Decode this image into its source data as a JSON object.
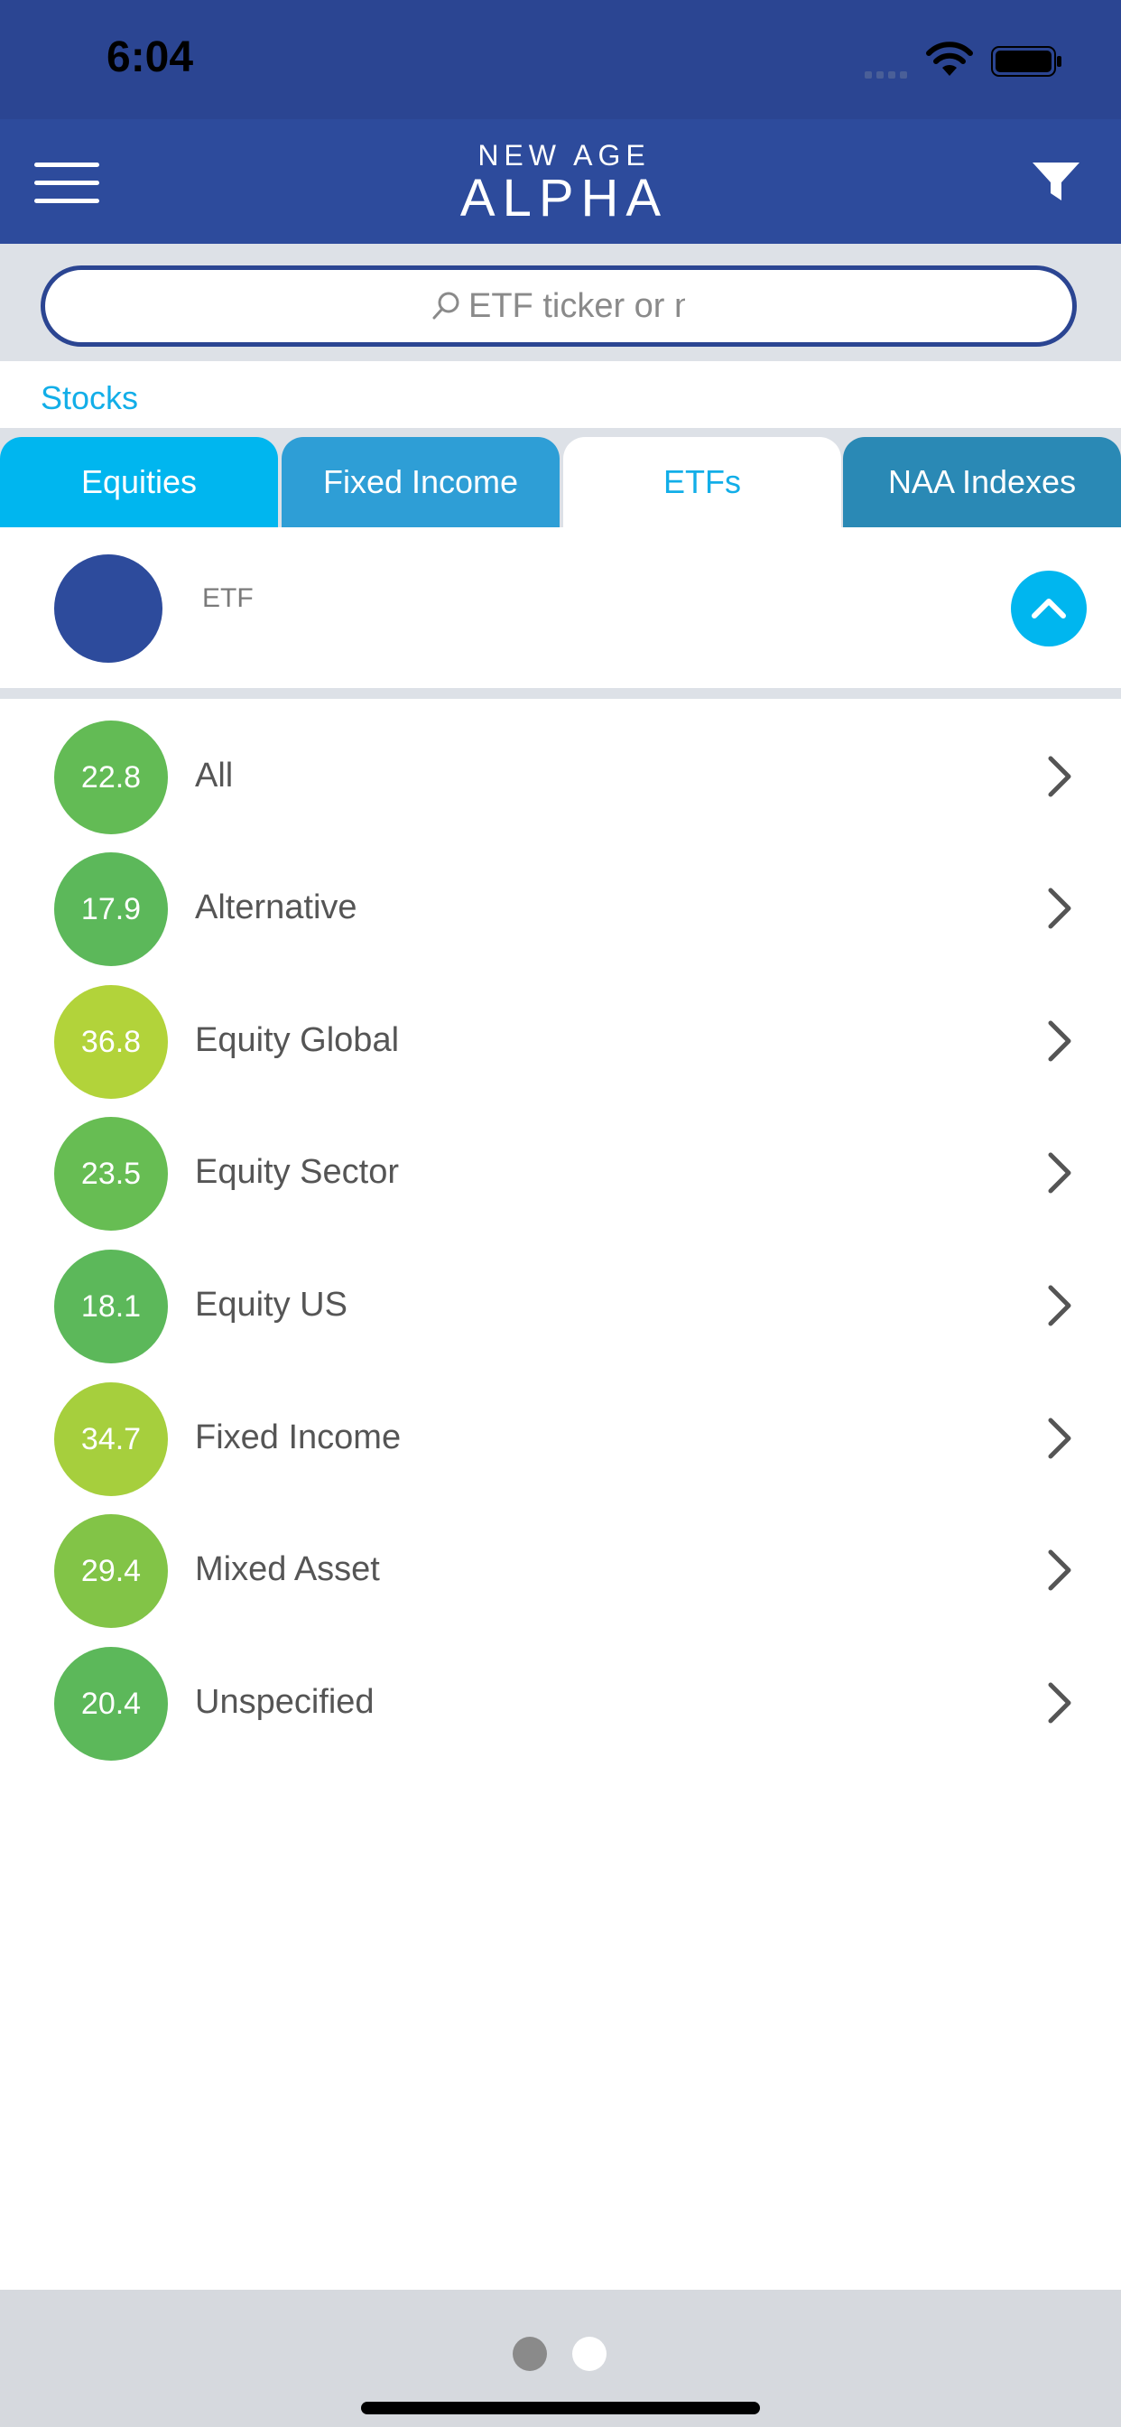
{
  "status_bar": {
    "time": "6:04"
  },
  "header": {
    "logo_line1": "NEW AGE",
    "logo_line2": "ALPHA"
  },
  "search": {
    "placeholder": "ETF ticker or name"
  },
  "breadcrumb": {
    "label": "Stocks"
  },
  "tabs": [
    {
      "label": "Equities"
    },
    {
      "label": "Fixed Income"
    },
    {
      "label": "ETFs",
      "selected": true
    },
    {
      "label": "NAA Indexes"
    }
  ],
  "etf_header": {
    "label": "ETF"
  },
  "categories": [
    {
      "score": "22.8",
      "label": "All",
      "color": "#63bb55"
    },
    {
      "score": "17.9",
      "label": "Alternative",
      "color": "#5cb85a"
    },
    {
      "score": "36.8",
      "label": "Equity Global",
      "color": "#b2d33a"
    },
    {
      "score": "23.5",
      "label": "Equity Sector",
      "color": "#67bd53"
    },
    {
      "score": "18.1",
      "label": "Equity US",
      "color": "#5cb85a"
    },
    {
      "score": "34.7",
      "label": "Fixed Income",
      "color": "#a6cf3d"
    },
    {
      "score": "29.4",
      "label": "Mixed Asset",
      "color": "#82c447"
    },
    {
      "score": "20.4",
      "label": "Unspecified",
      "color": "#5cb85a"
    }
  ],
  "colors": {
    "status_bar": "#2b4592",
    "nav_bar": "#2d4b9c",
    "accent": "#00b6ef",
    "tab_selected_text": "#12aee8"
  },
  "page_indicator": {
    "count": 2,
    "current": 1
  }
}
